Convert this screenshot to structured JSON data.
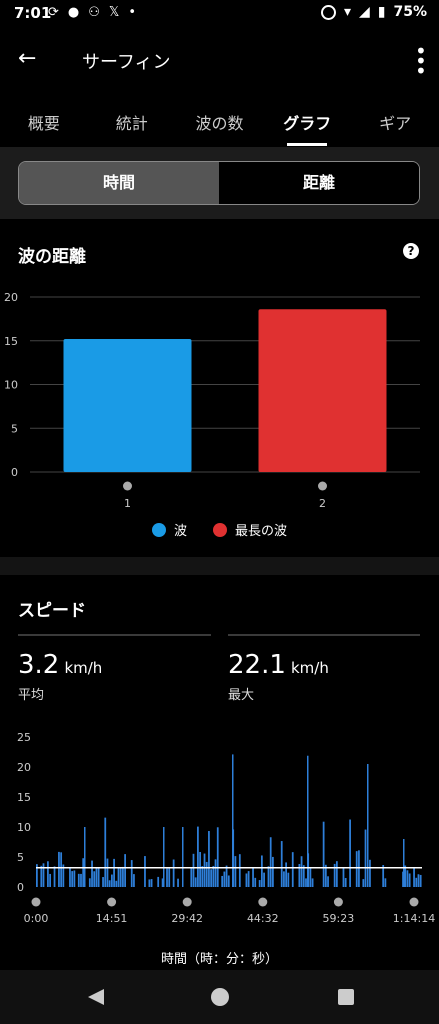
{
  "status": {
    "time": "7:01",
    "battery": "75%"
  },
  "appbar": {
    "title": "サーフィン"
  },
  "tabs": [
    "概要",
    "統計",
    "波の数",
    "グラフ",
    "ギア"
  ],
  "segment": {
    "left": "時間",
    "right": "距離"
  },
  "wave_card": {
    "title": "波の距離",
    "help": "?"
  },
  "speed_card": {
    "title": "スピード",
    "avg_value": "3.2",
    "avg_unit": "km/h",
    "avg_label": "平均",
    "max_value": "22.1",
    "max_unit": "km/h",
    "max_label": "最大",
    "xlabel": "時間（時：分：秒）"
  },
  "colors": {
    "wave": "#1a9be6",
    "longest": "#e03131",
    "speed": "#2e7fd9"
  },
  "chart_data": [
    {
      "type": "bar",
      "categories": [
        "1",
        "2"
      ],
      "values": [
        15.2,
        18.6
      ],
      "ylim": [
        0,
        20
      ],
      "yticks": [
        0,
        5,
        10,
        15,
        20
      ],
      "legend": [
        "波",
        "最長の波"
      ],
      "legend_placement": "bottom",
      "grid": true
    },
    {
      "type": "bar",
      "x_ticks": [
        "0:00",
        "14:51",
        "29:42",
        "44:32",
        "59:23",
        "1:14:14"
      ],
      "ylim": [
        0,
        25
      ],
      "yticks": [
        0,
        5,
        10,
        15,
        20,
        25
      ],
      "average": 3.2,
      "max": 22.1,
      "grid": false
    }
  ]
}
